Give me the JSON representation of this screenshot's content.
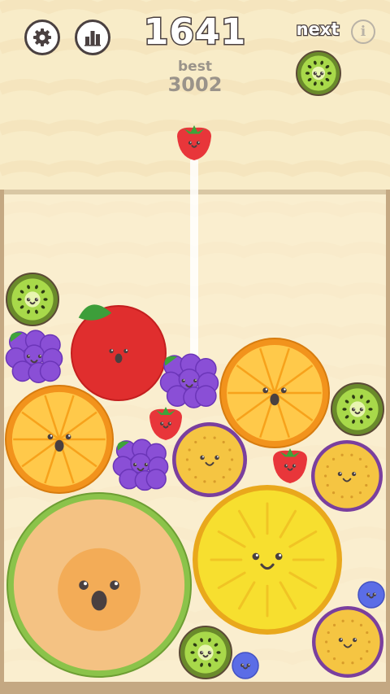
{
  "game": {
    "score": "1641",
    "best_label": "best",
    "best_value": "3002",
    "next_label": "next",
    "next_fruit": "kiwi",
    "current_fruit": "strawberry",
    "info_icon": "i"
  },
  "buttons": {
    "settings_icon": "gear-icon",
    "stats_icon": "bar-chart-icon"
  },
  "fruit_kinds": {
    "blueberry": {
      "size_rank": 1,
      "colors": [
        "#5b6de6",
        "#4352c2"
      ]
    },
    "strawberry": {
      "size_rank": 2,
      "colors": [
        "#e8363a",
        "#3fa33a"
      ]
    },
    "grape": {
      "size_rank": 3,
      "colors": [
        "#8a4fd6",
        "#6b35b8"
      ]
    },
    "kiwi": {
      "size_rank": 4,
      "colors": [
        "#6b9e2e",
        "#a8d94a"
      ]
    },
    "passionfruit": {
      "size_rank": 5,
      "colors": [
        "#f5c542",
        "#7a3f9e"
      ]
    },
    "apple": {
      "size_rank": 6,
      "colors": [
        "#e02e2e",
        "#3d9e3a"
      ]
    },
    "orange": {
      "size_rank": 7,
      "colors": [
        "#f7a21b",
        "#ffc94a"
      ]
    },
    "pineapple": {
      "size_rank": 8,
      "colors": [
        "#f7df2f",
        "#e9a81c"
      ]
    },
    "melon": {
      "size_rank": 9,
      "colors": [
        "#f4c283",
        "#8bc34a"
      ]
    }
  },
  "colors": {
    "background": "#f8ecc8",
    "container": "#fbf1d6",
    "wall": "#c4a882",
    "outline": "#4a4040"
  }
}
